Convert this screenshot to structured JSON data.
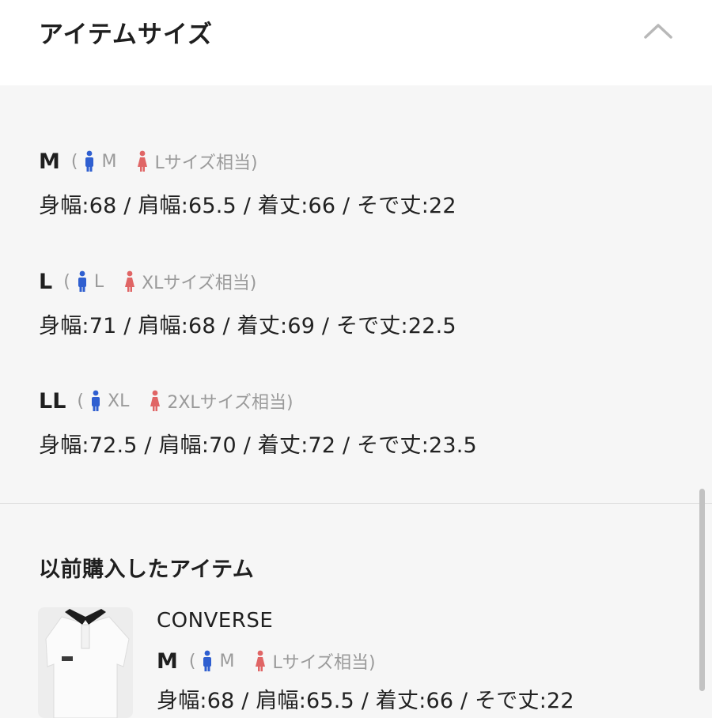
{
  "header": {
    "title": "アイテムサイズ"
  },
  "sizes": [
    {
      "size": "M",
      "open_paren": "(",
      "male_size": "M",
      "female_size": "Lサイズ相当)",
      "measurements": "身幅:68 / 肩幅:65.5 / 着丈:66 / そで丈:22"
    },
    {
      "size": "L",
      "open_paren": "(",
      "male_size": "L",
      "female_size": "XLサイズ相当)",
      "measurements": "身幅:71 / 肩幅:68 / 着丈:69 / そで丈:22.5"
    },
    {
      "size": "LL",
      "open_paren": "(",
      "male_size": "XL",
      "female_size": "2XLサイズ相当)",
      "measurements": "身幅:72.5 / 肩幅:70 / 着丈:72 / そで丈:23.5"
    }
  ],
  "previous": {
    "title": "以前購入したアイテム",
    "brand": "CONVERSE",
    "size": "M",
    "open_paren": "(",
    "male_size": "M",
    "female_size": "Lサイズ相当)",
    "measurements": "身幅:68 / 肩幅:65.5 / 着丈:66 / そで丈:22"
  },
  "colors": {
    "male_icon": "#2f5fd0",
    "female_icon": "#e06565",
    "accent_text": "#9a9a9a"
  },
  "icons": {
    "collapse": "chevron-up-icon",
    "male": "male-figure-icon",
    "female": "female-figure-icon"
  }
}
